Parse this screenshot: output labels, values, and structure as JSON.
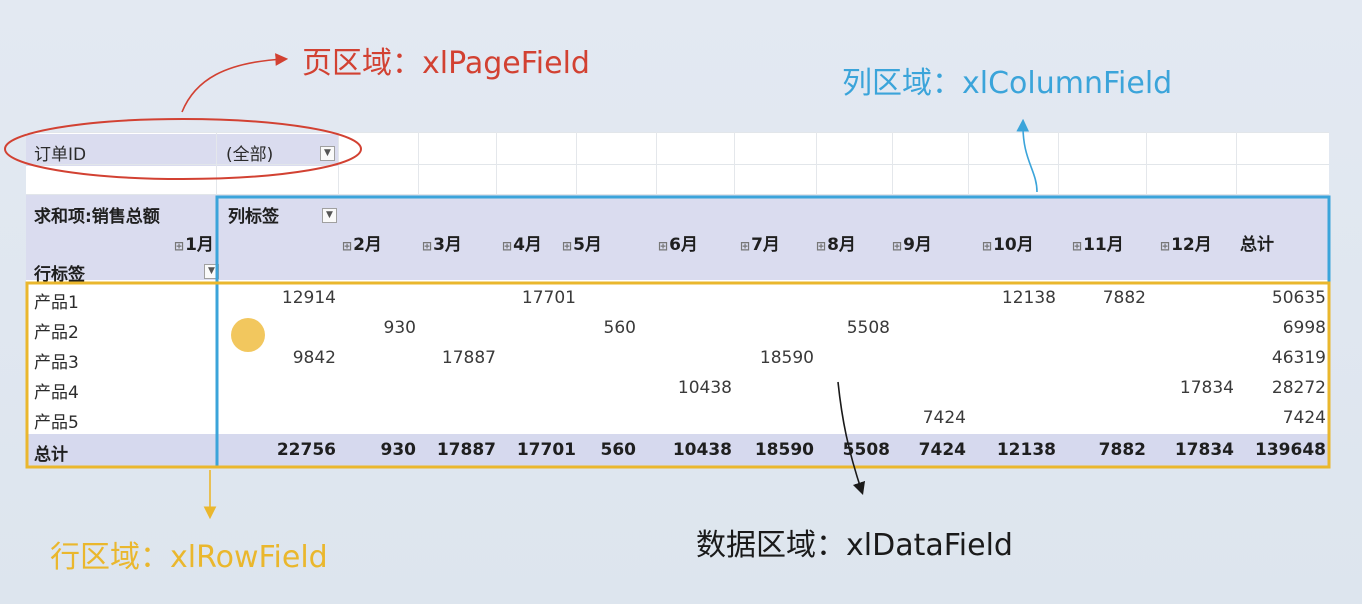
{
  "annotations": {
    "page": "页区域：xlPageField",
    "column": "列区域：xlColumnField",
    "row": "行区域：xlRowField",
    "data": "数据区域：xlDataField"
  },
  "colors": {
    "page_annotation": "#d24132",
    "column_annotation": "#3ba4da",
    "row_annotation": "#eab72d",
    "data_annotation": "#1a1a1a",
    "header_band": "#dadcef"
  },
  "page_field": {
    "label": "订单ID",
    "value": "(全部)"
  },
  "pivot": {
    "value_label": "求和项:销售总额",
    "column_labels_header": "列标签",
    "row_labels_header": "行标签",
    "months": [
      "1月",
      "2月",
      "3月",
      "4月",
      "5月",
      "6月",
      "7月",
      "8月",
      "9月",
      "10月",
      "11月",
      "12月"
    ],
    "grand_total_label": "总计",
    "rows": [
      {
        "label": "产品1",
        "values": [
          "12914",
          "",
          "",
          "17701",
          "",
          "",
          "",
          "",
          "",
          "12138",
          "7882",
          ""
        ],
        "total": "50635"
      },
      {
        "label": "产品2",
        "values": [
          "",
          "930",
          "",
          "",
          "560",
          "",
          "",
          "5508",
          "",
          "",
          "",
          ""
        ],
        "total": "6998"
      },
      {
        "label": "产品3",
        "values": [
          "9842",
          "",
          "17887",
          "",
          "",
          "",
          "18590",
          "",
          "",
          "",
          "",
          ""
        ],
        "total": "46319"
      },
      {
        "label": "产品4",
        "values": [
          "",
          "",
          "",
          "",
          "",
          "10438",
          "",
          "",
          "",
          "",
          "",
          "17834"
        ],
        "total": "28272"
      },
      {
        "label": "产品5",
        "values": [
          "",
          "",
          "",
          "",
          "",
          "",
          "",
          "",
          "7424",
          "",
          "",
          ""
        ],
        "total": "7424"
      }
    ],
    "totals": {
      "label": "总计",
      "values": [
        "22756",
        "930",
        "17887",
        "17701",
        "560",
        "10438",
        "18590",
        "5508",
        "7424",
        "12138",
        "7882",
        "17834"
      ],
      "grand": "139648"
    }
  },
  "icons": [
    "dropdown-arrow-icon",
    "expand-plus-icon",
    "mouse-pointer-icon"
  ]
}
